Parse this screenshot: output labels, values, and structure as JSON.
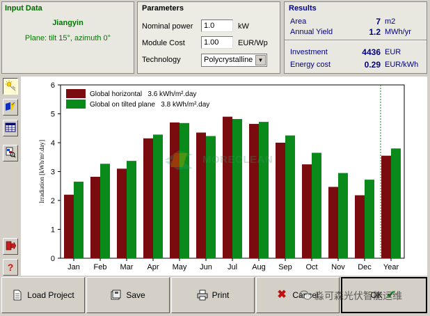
{
  "input_data": {
    "title": "Input Data",
    "city": "Jiangyin",
    "plane": "Plane: tilt 15°, azimuth 0°"
  },
  "parameters": {
    "title": "Parameters",
    "nominal_power": {
      "label": "Nominal power",
      "value": "1.0",
      "unit": "kW"
    },
    "module_cost": {
      "label": "Module Cost",
      "value": "1.00",
      "unit": "EUR/Wp"
    },
    "technology": {
      "label": "Technology",
      "value": "Polycrystalline"
    }
  },
  "results": {
    "title": "Results",
    "area": {
      "label": "Area",
      "value": "7",
      "unit": "m2"
    },
    "annual_yield": {
      "label": "Annual Yield",
      "value": "1.2",
      "unit": "MWh/yr"
    },
    "investment": {
      "label": "Investment",
      "value": "4436",
      "unit": "EUR"
    },
    "energy_cost": {
      "label": "Energy cost",
      "value": "0.29",
      "unit": "EUR/kWh"
    }
  },
  "toolbar": {
    "items": [
      {
        "icon": "sun-icon"
      },
      {
        "icon": "panel-settings-icon"
      },
      {
        "icon": "table-icon"
      },
      {
        "icon": "print-preview-icon"
      },
      {
        "icon": "exit-icon"
      },
      {
        "icon": "help-icon"
      }
    ]
  },
  "buttons": {
    "load_project": "Load Project",
    "save": "Save",
    "print": "Print",
    "cancel": "Cancel",
    "ok": "OK"
  },
  "watermarks": {
    "center": "MORECLEAN",
    "bottom": "淼可森光伏智能运维"
  },
  "colors": {
    "horizontal": "#7a0c10",
    "tilted": "#0a8a1a",
    "results_text": "#000080",
    "input_text": "#007700"
  },
  "chart_data": {
    "type": "bar",
    "title": "",
    "xlabel": "",
    "ylabel": "Irradiation [kWh/m².day]",
    "ylim": [
      0,
      6
    ],
    "yticks": [
      "0",
      "1",
      "2",
      "3",
      "4",
      "5",
      "6"
    ],
    "categories": [
      "Jan",
      "Feb",
      "Mar",
      "Apr",
      "May",
      "Jun",
      "Jul",
      "Aug",
      "Sep",
      "Oct",
      "Nov",
      "Dec",
      "Year"
    ],
    "series": [
      {
        "name": "Global horizontal",
        "legend": "Global horizontal   3.6 kWh/m².day",
        "values": [
          2.2,
          2.82,
          3.1,
          4.15,
          4.7,
          4.35,
          4.9,
          4.65,
          4.0,
          3.25,
          2.47,
          2.18,
          3.55
        ]
      },
      {
        "name": "Global on tilted plane",
        "legend": "Global on tilted plane   3.8 kWh/m².day",
        "values": [
          2.65,
          3.27,
          3.37,
          4.28,
          4.68,
          4.23,
          4.82,
          4.72,
          4.25,
          3.65,
          2.95,
          2.72,
          3.8
        ]
      }
    ],
    "grid": false,
    "legend_position": "top-left"
  }
}
